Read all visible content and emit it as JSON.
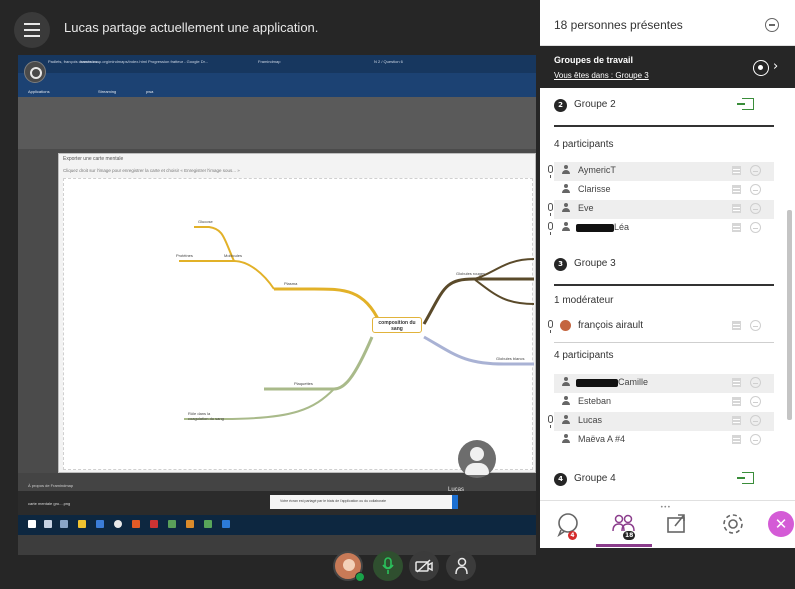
{
  "top": {
    "share_status": "Lucas partage actuellement une application."
  },
  "screen": {
    "browser_tabs": [
      "Padlets, françois cannas ou...",
      "Progression fratteur - Google Dr...",
      "Framindmap",
      "N 2 / Question 6"
    ],
    "address": "framindmap.org/mindmaps/index.html",
    "bookmarks": [
      "Applications",
      "Streaming",
      "pwa"
    ],
    "export_title": "Exporter une carte mentale",
    "export_hint": "Cliquez droit sur l'image pour enregistrer la carte et choisir « Enregistrer l'image sous... »",
    "mindmap": {
      "center": "composition du sang",
      "nodes": [
        "Glucose",
        "Protéines",
        "Molécules",
        "Plasma",
        "Globules rouges",
        "Plaquettes",
        "Rôle dans la coagulation du sang",
        "Globules blancs"
      ]
    },
    "footer_text": "À propos de Framindmap",
    "download_file": "carte mentale gro....png",
    "share_notice": "Votre écran est partagé par le biais de l'application ou du collaborate",
    "presenter_name": "Lucas"
  },
  "panel": {
    "attendees_title": "18 personnes présentes",
    "groups_title": "Groupes de travail",
    "groups_subtitle": "Vous êtes dans : Groupe 3",
    "groups": [
      {
        "number": "2",
        "label": "Groupe 2",
        "participants_label": "4 participants",
        "participants": [
          {
            "name": "AymericT",
            "mic": true
          },
          {
            "name": "Clarisse",
            "mic": false
          },
          {
            "name": "Eve",
            "mic": true
          },
          {
            "name": "Léa",
            "mic": true
          }
        ]
      },
      {
        "number": "3",
        "label": "Groupe 3",
        "moderators_label": "1 modérateur",
        "moderator": "françois airault",
        "participants_label": "4 participants",
        "participants": [
          {
            "name": "Camille",
            "mic": false
          },
          {
            "name": "Esteban",
            "mic": false
          },
          {
            "name": "Lucas",
            "mic": true
          },
          {
            "name": "Maëva A #4",
            "mic": false
          }
        ]
      },
      {
        "number": "4",
        "label": "Groupe 4"
      }
    ],
    "tabs": {
      "chat_badge": "4",
      "attendees_badge": "18"
    }
  },
  "colors": {
    "accent": "#d45bd6",
    "active_tab": "#8b3d8c",
    "mic_on": "#19a24a",
    "alert": "#d42b2b"
  }
}
